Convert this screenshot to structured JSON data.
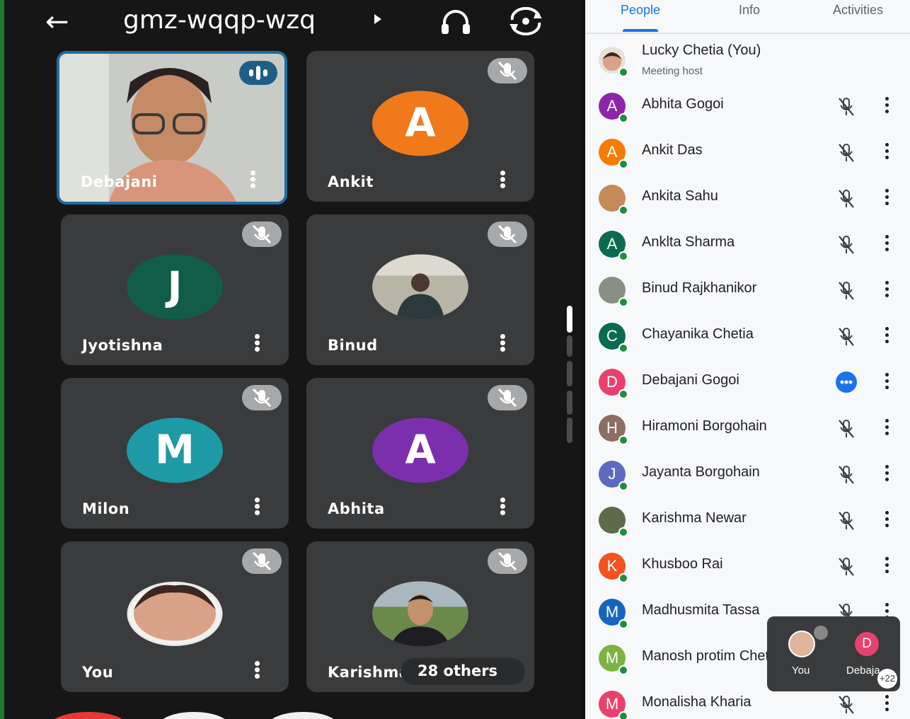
{
  "meeting": {
    "code": "gmz-wqqp-wzq",
    "back_icon": "arrow-left-icon",
    "audio_icon": "headphones-icon",
    "camera_icon": "switch-camera-icon"
  },
  "tiles": [
    {
      "name": "Debajani",
      "type": "video",
      "speaking": true
    },
    {
      "name": "Ankit",
      "type": "letter",
      "letter": "A",
      "color": "#f07a1a",
      "muted": true
    },
    {
      "name": "Jyotishna",
      "type": "letter",
      "letter": "J",
      "color": "#115d4a",
      "muted": true
    },
    {
      "name": "Binud",
      "type": "photo",
      "muted": true
    },
    {
      "name": "Milon",
      "type": "letter",
      "letter": "M",
      "color": "#1d9aa6",
      "muted": true
    },
    {
      "name": "Abhita",
      "type": "letter",
      "letter": "A",
      "color": "#7b2fad",
      "muted": true
    },
    {
      "name": "You",
      "type": "photo",
      "muted": true
    },
    {
      "name": "Karishma",
      "type": "photo",
      "muted": true
    }
  ],
  "others_label": "28 others",
  "panel": {
    "tabs": [
      "People",
      "Info",
      "Activities"
    ],
    "active_tab": "People",
    "host": {
      "name": "Lucky Chetia (You)",
      "role": "Meeting host"
    },
    "participants": [
      {
        "name": "Abhita Gogoi",
        "letter": "A",
        "color": "#8e24aa"
      },
      {
        "name": "Ankit Das",
        "letter": "A",
        "color": "#f57c00"
      },
      {
        "name": "Ankita Sahu",
        "letter": "",
        "color": "#c48a58"
      },
      {
        "name": "Anklta Sharma",
        "letter": "A",
        "color": "#0b6b4f"
      },
      {
        "name": "Binud Rajkhanikor",
        "letter": "",
        "color": "#8a8f86"
      },
      {
        "name": "Chayanika Chetia",
        "letter": "C",
        "color": "#0b6b4f"
      },
      {
        "name": "Debajani Gogoi",
        "letter": "D",
        "color": "#e8416f",
        "speaking": true
      },
      {
        "name": "Hiramoni Borgohain",
        "letter": "H",
        "color": "#8d6e63"
      },
      {
        "name": "Jayanta Borgohain",
        "letter": "J",
        "color": "#5c6bc0"
      },
      {
        "name": "Karishma Newar",
        "letter": "",
        "color": "#5d6b4a"
      },
      {
        "name": "Khusboo Rai",
        "letter": "K",
        "color": "#f4511e"
      },
      {
        "name": "Madhusmita Tassa",
        "letter": "M",
        "color": "#1565c0"
      },
      {
        "name": "Manosh protim Chet",
        "letter": "M",
        "color": "#7cb342"
      },
      {
        "name": "Monalisha Kharia",
        "letter": "M",
        "color": "#e8416f"
      }
    ]
  },
  "pip": {
    "you": "You",
    "other": "Debaja",
    "other_letter": "D",
    "count": "+22"
  }
}
